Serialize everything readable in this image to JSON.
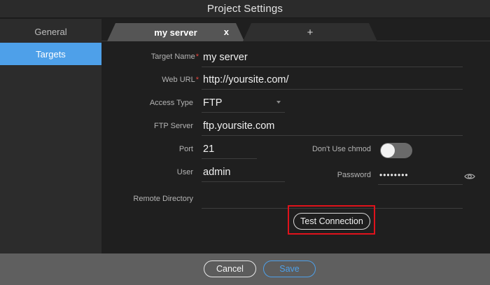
{
  "window": {
    "title": "Project Settings"
  },
  "sidebar": {
    "items": [
      {
        "label": "General"
      },
      {
        "label": "Targets"
      }
    ]
  },
  "tabs": {
    "active_label": "my server",
    "close_label": "x",
    "add_label": "+"
  },
  "form": {
    "target_name": {
      "label": "Target Name",
      "required_mark": "*",
      "value": "my server"
    },
    "web_url": {
      "label": "Web URL",
      "required_mark": "*",
      "value": "http://yoursite.com/"
    },
    "access_type": {
      "label": "Access Type",
      "value": "FTP"
    },
    "ftp_server": {
      "label": "FTP Server",
      "value": "ftp.yoursite.com"
    },
    "port": {
      "label": "Port",
      "value": "21"
    },
    "chmod": {
      "label": "Don't Use chmod",
      "enabled": false
    },
    "user": {
      "label": "User",
      "value": "admin"
    },
    "password": {
      "label": "Password",
      "value": "••••••••"
    },
    "remote_directory": {
      "label": "Remote Directory",
      "value": ""
    }
  },
  "buttons": {
    "test_connection": "Test Connection",
    "cancel": "Cancel",
    "save": "Save"
  },
  "colors": {
    "accent": "#4ea0e9",
    "highlight": "#e0121b",
    "required": "#e5463e"
  },
  "icons": {
    "password_reveal": "eye-icon",
    "access_type_dropdown": "chevron-down-icon"
  }
}
